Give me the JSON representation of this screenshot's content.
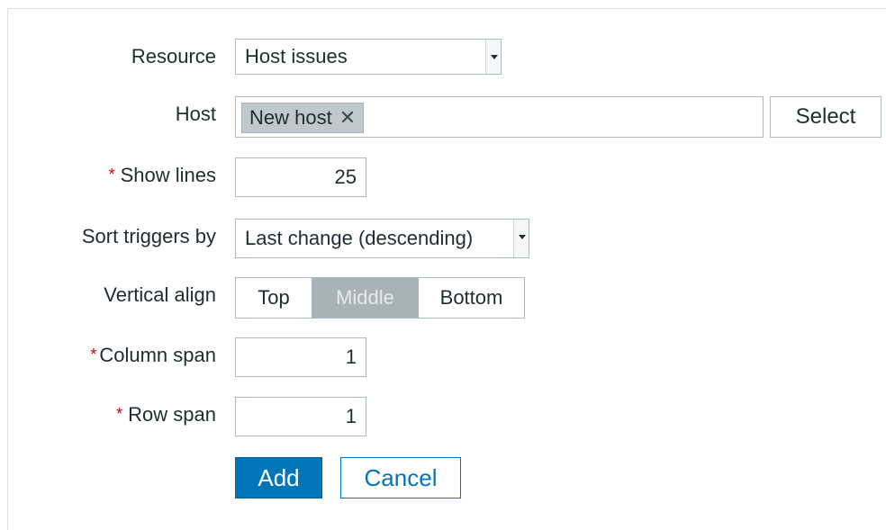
{
  "form": {
    "resource": {
      "label": "Resource",
      "value": "Host issues"
    },
    "host": {
      "label": "Host",
      "chip": "New host",
      "chip_remove_glyph": "✕",
      "select_label": "Select"
    },
    "show_lines": {
      "label": "Show lines",
      "required_mark": "*",
      "value": "25"
    },
    "sort_triggers": {
      "label": "Sort triggers by",
      "value": "Last change (descending)"
    },
    "vertical_align": {
      "label": "Vertical align",
      "options": [
        "Top",
        "Middle",
        "Bottom"
      ],
      "selected": "Middle"
    },
    "column_span": {
      "label": "Column span",
      "required_mark": "*",
      "value": "1"
    },
    "row_span": {
      "label": "Row span",
      "required_mark": "*",
      "value": "1"
    },
    "buttons": {
      "add": "Add",
      "cancel": "Cancel"
    }
  },
  "colors": {
    "accent": "#0275b8",
    "required": "#d40000",
    "chip_bg": "#bfc8cd",
    "selected_option_bg": "#a8b3b9"
  },
  "icons": {
    "dropdown": "chevron-down-icon",
    "remove": "close-icon"
  }
}
